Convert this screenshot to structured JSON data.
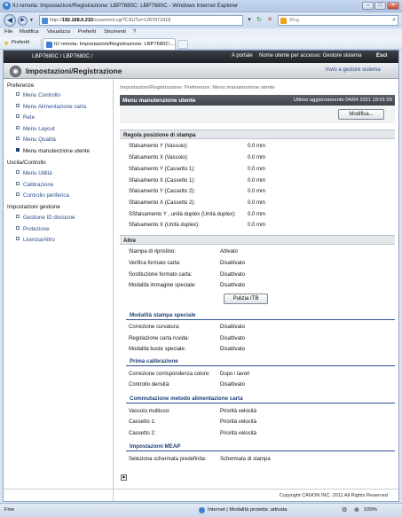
{
  "window": {
    "title": "IU remota: Impostazioni/Registrazione: LBP7680C: LBP7680C - Windows Internet Explorer",
    "min": "–",
    "max": "□",
    "close": "✕"
  },
  "address": {
    "url_prefix": "http://",
    "url_host": "192.168.0.215",
    "url_path": "/cusermnt.cgi?CSUTu=1287871818",
    "search_placeholder": "Bing"
  },
  "menubar": [
    "File",
    "Modifica",
    "Visualizza",
    "Preferiti",
    "Strumenti",
    "?"
  ],
  "favorites": {
    "label": "Preferiti",
    "tab_title": "IU remota: Impostazioni/Registrazione: LBP7680C:..."
  },
  "top": {
    "model": "LBP7680C / LBP7680C /",
    "portal": "A portale",
    "user": "Nome utente per accesso: Gestore sistema",
    "logout": "Esci"
  },
  "header": {
    "title": "Impostazioni/Registrazione",
    "send_admin": "Invio a gestore sistema"
  },
  "sidebar": {
    "groups": [
      {
        "label": "Preferenze",
        "items": [
          "Menu Controllo",
          "Menu Alimentazione carta",
          "Rete",
          "Menu Layout",
          "Menu Qualità",
          "Menu manutenzione utente"
        ]
      },
      {
        "label": "Uscita/Controllo",
        "items": [
          "Menu Utilità",
          "Calibrazione",
          "Controllo periferica"
        ]
      },
      {
        "label": "Impostazioni gestione",
        "items": [
          "Gestione ID divisione",
          "Protezione",
          "Licenza/Altro"
        ]
      }
    ],
    "active": "Menu manutenzione utente"
  },
  "main": {
    "breadcrumb": "Impostazioni/Registrazione: Preferenze: Menu manutenzione utente",
    "panel_title": "Menu manutenzione utente",
    "last_update": "Ultimo aggiornamento 04/04 2011 19:01:59",
    "modify": "Modifica...",
    "section1": {
      "title": "Regola posizione di stampa",
      "rows": [
        {
          "label": "Sfalsamento Y (Vassoio):",
          "value": "0.0 mm"
        },
        {
          "label": "Sfalsamento X (Vassoio):",
          "value": "0.0 mm"
        },
        {
          "label": "Sfalsamento Y (Cassetto 1):",
          "value": "0.0 mm"
        },
        {
          "label": "Sfalsamento X (Cassetto 1):",
          "value": "0.0 mm"
        },
        {
          "label": "Sfalsamento Y (Cassetto 2):",
          "value": "0.0 mm"
        },
        {
          "label": "Sfalsamento X (Cassetto 2):",
          "value": "0.0 mm"
        },
        {
          "label": "SSfalsamento Y , unità duplex (Unità duplex):",
          "value": "0.0 mm"
        },
        {
          "label": "Sfalsamento X (Unità duplex):",
          "value": "0.0 mm"
        }
      ]
    },
    "section2": {
      "title": "Altre",
      "rows": [
        {
          "label": "Stampa di ripristino:",
          "value": "Attivato"
        },
        {
          "label": "Verifica formato carta:",
          "value": "Disattivato"
        },
        {
          "label": "Sostituzione formato carta:",
          "value": "Disattivato"
        },
        {
          "label": "Modalità immagine speciale:",
          "value": "Disattivato"
        }
      ],
      "clean_itb": "Pulizia ITB"
    },
    "subsections": [
      {
        "title": "Modalità stampa speciale",
        "rows": [
          {
            "label": "Correzione curvatura:",
            "value": "Disattivato"
          },
          {
            "label": "Regolazione carta ruvida:",
            "value": "Disattivato"
          },
          {
            "label": "Modalità buste speciale:",
            "value": "Disattivato"
          }
        ]
      },
      {
        "title": "Prima calibrazione",
        "rows": [
          {
            "label": "Correzione corrispondenza colore:",
            "value": "Dopo i lavori"
          },
          {
            "label": "Controllo densità:",
            "value": "Disattivato"
          }
        ]
      },
      {
        "title": "Commutazione metodo alimentazione carta",
        "rows": [
          {
            "label": "Vassoio multiuso:",
            "value": "Priorità velocità"
          },
          {
            "label": "Cassetto 1:",
            "value": "Priorità velocità"
          },
          {
            "label": "Cassetto 2:",
            "value": "Priorità velocità"
          }
        ]
      },
      {
        "title": "Impostazioni MEAP",
        "rows": [
          {
            "label": "Seleziona schermata predefinita:",
            "value": "Schermata di stampa"
          }
        ]
      }
    ],
    "copyright": "Copyright CANON INC. 2011 All Rights Reserved"
  },
  "status": {
    "left": "Fine",
    "zone": "Internet | Modalità protetta: attivata",
    "zoom": "100%"
  }
}
